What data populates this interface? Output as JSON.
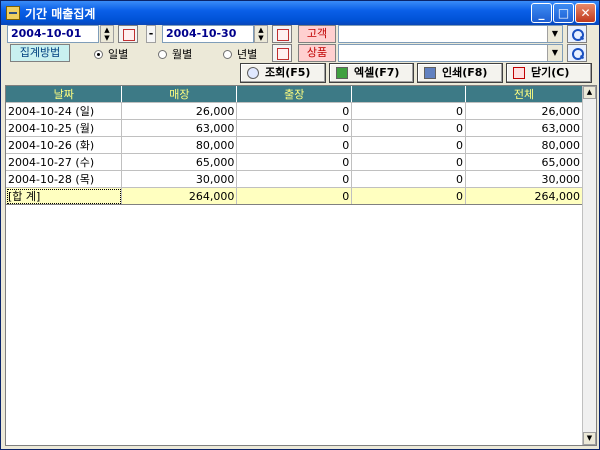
{
  "window": {
    "title": "기간 매출집계"
  },
  "filters": {
    "date_from": "2004-10-01",
    "date_to": "2004-10-30",
    "date_separator": "-",
    "customer_label": "고객",
    "customer_value": "",
    "product_label": "상품",
    "product_value": "",
    "aggregation_label": "집계방법",
    "aggregation_options": [
      {
        "label": "일별",
        "selected": true
      },
      {
        "label": "월별",
        "selected": false
      },
      {
        "label": "년별",
        "selected": false
      }
    ]
  },
  "actions": {
    "query": "조회(F5)",
    "excel": "엑셀(F7)",
    "print": "인쇄(F8)",
    "close": "닫기(C)"
  },
  "table": {
    "headers": [
      "날짜",
      "매장",
      "출장",
      "",
      "전체"
    ],
    "rows": [
      [
        "2004-10-24 (일)",
        "26,000",
        "0",
        "0",
        "26,000"
      ],
      [
        "2004-10-25 (월)",
        "63,000",
        "0",
        "0",
        "63,000"
      ],
      [
        "2004-10-26 (화)",
        "80,000",
        "0",
        "0",
        "80,000"
      ],
      [
        "2004-10-27 (수)",
        "65,000",
        "0",
        "0",
        "65,000"
      ],
      [
        "2004-10-28 (목)",
        "30,000",
        "0",
        "0",
        "30,000"
      ]
    ],
    "total": [
      "[합 계]",
      "264,000",
      "0",
      "0",
      "264,000"
    ]
  },
  "colors": {
    "header_bg": "#3d7a86",
    "header_text": "#ffff80",
    "total_bg": "#ffffc0",
    "titlebar": "#0a5fe8"
  },
  "icons": {
    "title": "app-icon",
    "calendar": "calendar-icon",
    "search": "search-icon",
    "query": "magnifier-icon",
    "excel": "excel-icon",
    "print": "printer-icon",
    "close": "close-icon"
  }
}
